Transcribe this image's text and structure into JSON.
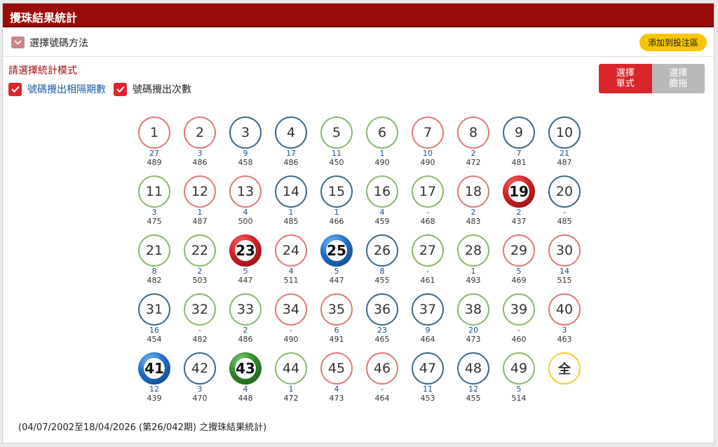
{
  "title": "攪珠結果統計",
  "method": {
    "label": "選擇號碼方法",
    "add_button": "添加到投注區"
  },
  "mode": {
    "title": "請選擇統計模式",
    "options": [
      {
        "label": "號碼攪出相隔期數",
        "checked": true
      },
      {
        "label": "號碼攪出次數",
        "checked": true
      }
    ]
  },
  "toggle": {
    "single": "選擇\n單式",
    "banker": "選擇\n膽拖",
    "active": "single"
  },
  "colors": {
    "red": "#e07a7a",
    "blue": "#3f6a86",
    "green": "#8cb86c",
    "header": "#9a0c0c"
  },
  "balls": [
    {
      "n": "1",
      "c": "red",
      "gap": "27",
      "count": "489"
    },
    {
      "n": "2",
      "c": "red",
      "gap": "3",
      "count": "486"
    },
    {
      "n": "3",
      "c": "blue",
      "gap": "9",
      "count": "458"
    },
    {
      "n": "4",
      "c": "blue",
      "gap": "17",
      "count": "486"
    },
    {
      "n": "5",
      "c": "green",
      "gap": "11",
      "count": "450"
    },
    {
      "n": "6",
      "c": "green",
      "gap": "1",
      "count": "490"
    },
    {
      "n": "7",
      "c": "red",
      "gap": "10",
      "count": "490"
    },
    {
      "n": "8",
      "c": "red",
      "gap": "2",
      "count": "472"
    },
    {
      "n": "9",
      "c": "blue",
      "gap": "7",
      "count": "481"
    },
    {
      "n": "10",
      "c": "blue",
      "gap": "21",
      "count": "487"
    },
    {
      "n": "11",
      "c": "green",
      "gap": "3",
      "count": "475"
    },
    {
      "n": "12",
      "c": "red",
      "gap": "1",
      "count": "487"
    },
    {
      "n": "13",
      "c": "red",
      "gap": "4",
      "count": "500"
    },
    {
      "n": "14",
      "c": "blue",
      "gap": "1",
      "count": "485"
    },
    {
      "n": "15",
      "c": "blue",
      "gap": "1",
      "count": "466"
    },
    {
      "n": "16",
      "c": "green",
      "gap": "4",
      "count": "459"
    },
    {
      "n": "17",
      "c": "green",
      "gap": "-",
      "count": "468"
    },
    {
      "n": "18",
      "c": "red",
      "gap": "2",
      "count": "483"
    },
    {
      "n": "19",
      "c": "red",
      "gap": "2",
      "count": "437",
      "sel": true
    },
    {
      "n": "20",
      "c": "blue",
      "gap": "-",
      "count": "485"
    },
    {
      "n": "21",
      "c": "green",
      "gap": "8",
      "count": "482"
    },
    {
      "n": "22",
      "c": "green",
      "gap": "2",
      "count": "503"
    },
    {
      "n": "23",
      "c": "red",
      "gap": "5",
      "count": "447",
      "sel": true
    },
    {
      "n": "24",
      "c": "red",
      "gap": "4",
      "count": "511"
    },
    {
      "n": "25",
      "c": "blue",
      "gap": "5",
      "count": "447",
      "sel": true
    },
    {
      "n": "26",
      "c": "blue",
      "gap": "8",
      "count": "455"
    },
    {
      "n": "27",
      "c": "green",
      "gap": "-",
      "count": "461"
    },
    {
      "n": "28",
      "c": "green",
      "gap": "1",
      "count": "493"
    },
    {
      "n": "29",
      "c": "red",
      "gap": "5",
      "count": "469"
    },
    {
      "n": "30",
      "c": "red",
      "gap": "14",
      "count": "515"
    },
    {
      "n": "31",
      "c": "blue",
      "gap": "16",
      "count": "454"
    },
    {
      "n": "32",
      "c": "green",
      "gap": "-",
      "count": "482"
    },
    {
      "n": "33",
      "c": "green",
      "gap": "2",
      "count": "486"
    },
    {
      "n": "34",
      "c": "red",
      "gap": "-",
      "count": "490"
    },
    {
      "n": "35",
      "c": "red",
      "gap": "6",
      "count": "491"
    },
    {
      "n": "36",
      "c": "blue",
      "gap": "23",
      "count": "465"
    },
    {
      "n": "37",
      "c": "blue",
      "gap": "9",
      "count": "464"
    },
    {
      "n": "38",
      "c": "green",
      "gap": "20",
      "count": "473"
    },
    {
      "n": "39",
      "c": "green",
      "gap": "-",
      "count": "460"
    },
    {
      "n": "40",
      "c": "red",
      "gap": "3",
      "count": "463"
    },
    {
      "n": "41",
      "c": "blue",
      "gap": "12",
      "count": "439",
      "sel": true
    },
    {
      "n": "42",
      "c": "blue",
      "gap": "3",
      "count": "470"
    },
    {
      "n": "43",
      "c": "green",
      "gap": "4",
      "count": "448",
      "sel": true
    },
    {
      "n": "44",
      "c": "green",
      "gap": "1",
      "count": "472"
    },
    {
      "n": "45",
      "c": "red",
      "gap": "4",
      "count": "473"
    },
    {
      "n": "46",
      "c": "red",
      "gap": "-",
      "count": "464"
    },
    {
      "n": "47",
      "c": "blue",
      "gap": "11",
      "count": "453"
    },
    {
      "n": "48",
      "c": "blue",
      "gap": "12",
      "count": "455"
    },
    {
      "n": "49",
      "c": "green",
      "gap": "5",
      "count": "514"
    },
    {
      "n": "全",
      "c": "all",
      "gap": "",
      "count": ""
    }
  ],
  "footer": "(04/07/2002至18/04/2026 (第26/042期) 之攪珠結果統計)"
}
